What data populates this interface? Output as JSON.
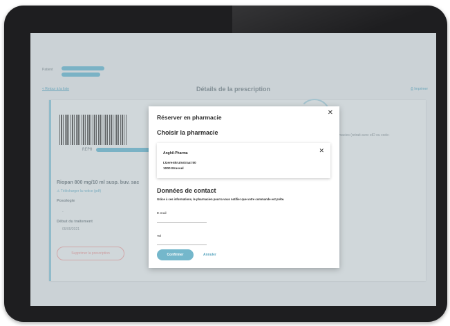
{
  "page": {
    "patient_label": "Patient",
    "back_link": "< Retour à la liste",
    "title": "Détails de la prescription",
    "print_link": "⎙ Imprimer"
  },
  "prescription": {
    "barcode_code": "REP0",
    "drug_name": "Riopan 800 mg/10 ml susp. buv. sac",
    "notice_link": "⚠ Télécharger la notice (pdf)",
    "posology_label": "Posologie",
    "posology_value": "-",
    "start_label": "Début du traitement",
    "start_value": "05/05/2021",
    "delete_button": "Supprimer la prescription",
    "side_text": "macies (retrait avec eID ou code-"
  },
  "modal": {
    "title": "Réserver en pharmacie",
    "close": "✕",
    "choose_title": "Choisir la pharmacie",
    "pharmacy": {
      "name": "Anghil-Pharma",
      "street": "IJzerenkruisstraat 50",
      "city": "1000 Brussel",
      "remove": "✕"
    },
    "contact_title": "Données de contact",
    "contact_desc": "Grâce à ces informations, le pharmacien pourra vous notifier que votre commande est prête.",
    "email_label": "E-mail",
    "tel_label": "Tel",
    "confirm_button": "Confirmer",
    "cancel_button": "Annuler"
  },
  "colors": {
    "accent": "#74b7cb",
    "link": "#5aa5bf",
    "danger": "#e39a9a",
    "device": "#1e1e20"
  }
}
